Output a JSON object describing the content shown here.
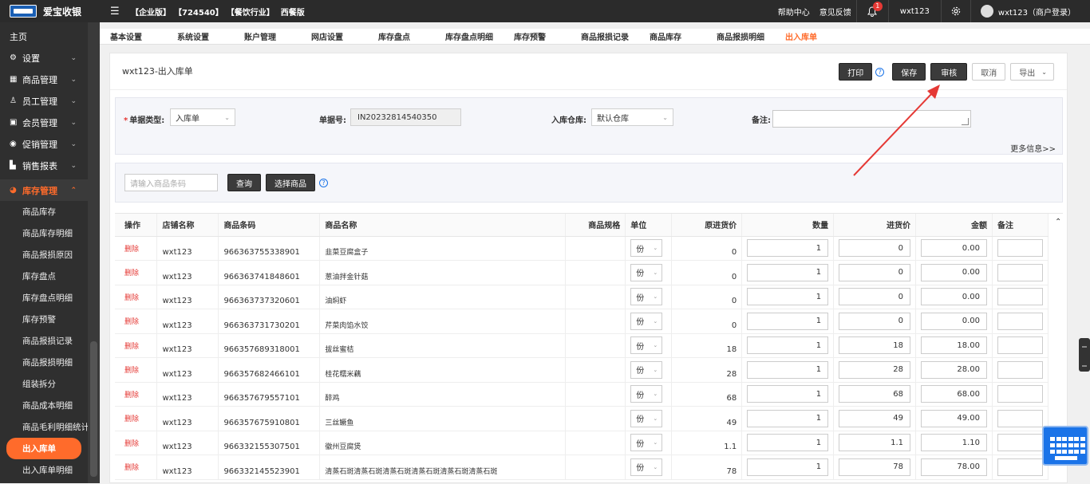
{
  "topbar": {
    "brand": "爱宝收银",
    "tags": [
      "【企业版】",
      "【724540】",
      "【餐饮行业】",
      "西餐版"
    ],
    "help": "帮助中心",
    "feedback": "意见反馈",
    "notif_count": "1",
    "username": "wxt123",
    "account": "wxt123（商户登录）"
  },
  "sidebar": {
    "home": "主页",
    "items": [
      {
        "label": "设置",
        "icon": "gear-icon"
      },
      {
        "label": "商品管理",
        "icon": "grid-icon"
      },
      {
        "label": "员工管理",
        "icon": "user-icon"
      },
      {
        "label": "会员管理",
        "icon": "member-icon"
      },
      {
        "label": "促销管理",
        "icon": "check-circle-icon"
      },
      {
        "label": "销售报表",
        "icon": "bar-chart-icon"
      }
    ],
    "open_group": "库存管理",
    "subitems": [
      "商品库存",
      "商品库存明细",
      "商品报损原因",
      "库存盘点",
      "库存盘点明细",
      "库存预警",
      "商品报损记录",
      "商品报损明细",
      "组装拆分",
      "商品成本明细",
      "商品毛利明细统计",
      "出入库单",
      "出入库单明细"
    ],
    "current": "出入库单"
  },
  "tabs": [
    "基本设置",
    "系统设置",
    "账户管理",
    "网店设置",
    "库存盘点",
    "库存盘点明细",
    "库存预警",
    "商品报损记录",
    "商品库存",
    "商品报损明细",
    "出入库单"
  ],
  "header": {
    "title": "wxt123-出入库单",
    "print": "打印",
    "save": "保存",
    "audit": "审核",
    "cancel": "取消",
    "export": "导出"
  },
  "form": {
    "type_label": "单据类型:",
    "type_value": "入库单",
    "no_label": "单据号:",
    "no_value": "IN20232814540350",
    "warehouse_label": "入库仓库:",
    "warehouse_value": "默认仓库",
    "remark_label": "备注:",
    "more": "更多信息>>"
  },
  "search": {
    "placeholder": "请输入商品条码",
    "query": "查询",
    "select": "选择商品"
  },
  "table": {
    "headers": [
      "操作",
      "店铺名称",
      "商品条码",
      "商品名称",
      "商品规格",
      "单位",
      "原进货价",
      "数量",
      "进货价",
      "金额",
      "备注"
    ],
    "delete_label": "删除",
    "rows": [
      {
        "shop": "wxt123",
        "code": "966363755338901",
        "name": "韭菜豆腐盒子",
        "unit": "份",
        "orig": "0",
        "qty": "1",
        "price": "0",
        "amount": "0.00"
      },
      {
        "shop": "wxt123",
        "code": "966363741848601",
        "name": "葱油拌金针菇",
        "unit": "份",
        "orig": "0",
        "qty": "1",
        "price": "0",
        "amount": "0.00"
      },
      {
        "shop": "wxt123",
        "code": "966363737320601",
        "name": "油焖虾",
        "unit": "份",
        "orig": "0",
        "qty": "1",
        "price": "0",
        "amount": "0.00"
      },
      {
        "shop": "wxt123",
        "code": "966363731730201",
        "name": "芹菜肉馅水饺",
        "unit": "份",
        "orig": "0",
        "qty": "1",
        "price": "0",
        "amount": "0.00"
      },
      {
        "shop": "wxt123",
        "code": "966357689318001",
        "name": "拔丝蜜桔",
        "unit": "份",
        "orig": "18",
        "qty": "1",
        "price": "18",
        "amount": "18.00"
      },
      {
        "shop": "wxt123",
        "code": "966357682466101",
        "name": "桂花糯米藕",
        "unit": "份",
        "orig": "28",
        "qty": "1",
        "price": "28",
        "amount": "28.00"
      },
      {
        "shop": "wxt123",
        "code": "966357679557101",
        "name": "醉鸡",
        "unit": "份",
        "orig": "68",
        "qty": "1",
        "price": "68",
        "amount": "68.00"
      },
      {
        "shop": "wxt123",
        "code": "966357675910801",
        "name": "三丝鳜鱼",
        "unit": "份",
        "orig": "49",
        "qty": "1",
        "price": "49",
        "amount": "49.00"
      },
      {
        "shop": "wxt123",
        "code": "966332155307501",
        "name": "徽州豆腐煲",
        "unit": "份",
        "orig": "1.1",
        "qty": "1",
        "price": "1.1",
        "amount": "1.10"
      },
      {
        "shop": "wxt123",
        "code": "966332145523901",
        "name": "清蒸石斑清蒸石斑清蒸石斑清蒸石斑清蒸石斑清蒸石斑",
        "unit": "份",
        "orig": "78",
        "qty": "1",
        "price": "78",
        "amount": "78.00"
      }
    ]
  }
}
